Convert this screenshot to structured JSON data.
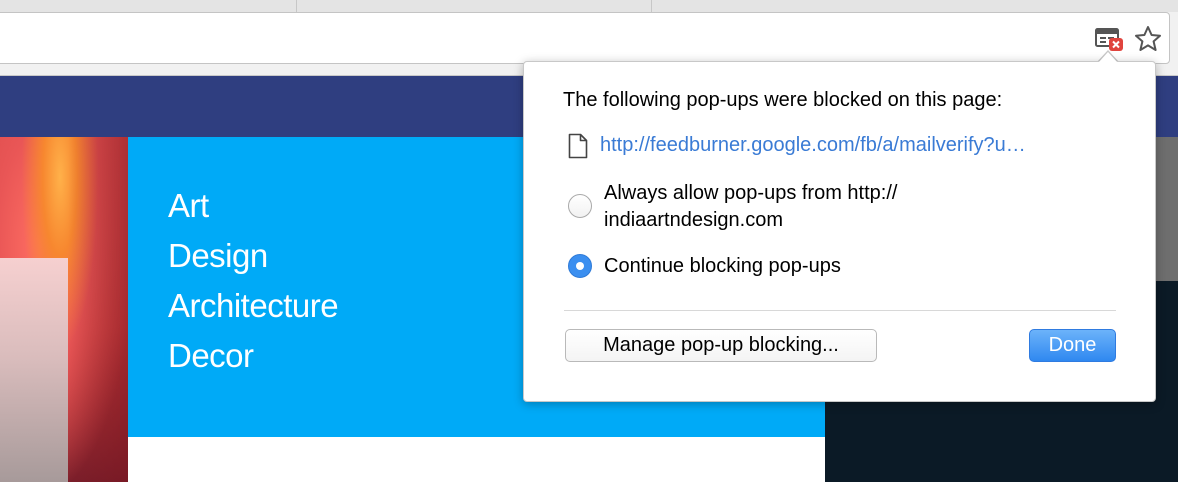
{
  "browser": {
    "toolbar_icons": [
      "popup-blocked-icon",
      "star-icon"
    ]
  },
  "page": {
    "categories": [
      "Art",
      "Design",
      "Architecture",
      "Decor"
    ],
    "colors": {
      "navbar": "#2f3e80",
      "category_panel": "#00aaf7",
      "dark_panel": "#0b1a26"
    }
  },
  "popup_bubble": {
    "title": "The following pop-ups were blocked on this page:",
    "blocked_url": "http://feedburner.google.com/fb/a/mailverify?u…",
    "options": [
      {
        "label": "Always allow pop-ups from http:// indiaartndesign.com",
        "selected": false
      },
      {
        "label": "Continue blocking pop-ups",
        "selected": true
      }
    ],
    "manage_label": "Manage pop-up blocking...",
    "done_label": "Done",
    "accent_color": "#3b8ff0"
  }
}
